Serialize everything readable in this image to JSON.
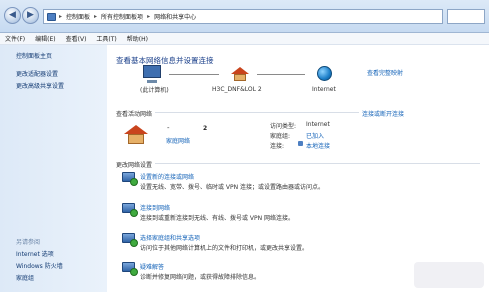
{
  "address_bar": {
    "back_icon": "back-arrow-icon",
    "forward_icon": "forward-arrow-icon",
    "segments": [
      "控制面板",
      "所有控制面板项",
      "网络和共享中心"
    ],
    "separator": "▸"
  },
  "menu": [
    "文件(F)",
    "编辑(E)",
    "查看(V)",
    "工具(T)",
    "帮助(H)"
  ],
  "sidebar": {
    "items": [
      "控制面板主页",
      "更改适配器设置",
      "更改高级共享设置"
    ],
    "see_also": "另请参阅",
    "bottom_items": [
      "Internet 选项",
      "Windows 防火墙",
      "家庭组"
    ]
  },
  "main": {
    "heading": "查看基本网络信息并设置连接",
    "full_map_link": "查看完整映射",
    "map": {
      "computer_label": "(此计算机)",
      "network_label": "H3C_DNF&LOL  2",
      "internet_label": "Internet"
    },
    "active_networks_title": "查看活动网络",
    "connect_disconnect_link": "连接或断开连接",
    "active_network": {
      "name": "-",
      "number": "2",
      "type_link": "家庭网络",
      "access_type_key": "访问类型:",
      "access_type_value": "Internet",
      "homegroup_key": "家庭组:",
      "homegroup_value": "已加入",
      "connections_key": "连接:",
      "connections_value": "本地连接"
    },
    "change_settings_title": "更改网络设置",
    "tasks": [
      {
        "title": "设置新的连接或网络",
        "desc": "设置无线、宽带、拨号、临时或 VPN 连接；或设置路由器或访问点。"
      },
      {
        "title": "连接到网络",
        "desc": "连接到或重新连接到无线、有线、拨号或 VPN 网络连接。"
      },
      {
        "title": "选择家庭组和共享选项",
        "desc": "访问位于其他网络计算机上的文件和打印机，或更改共享设置。"
      },
      {
        "title": "疑难解答",
        "desc": "诊断并修复网络问题，或获得故障排除信息。"
      }
    ]
  }
}
